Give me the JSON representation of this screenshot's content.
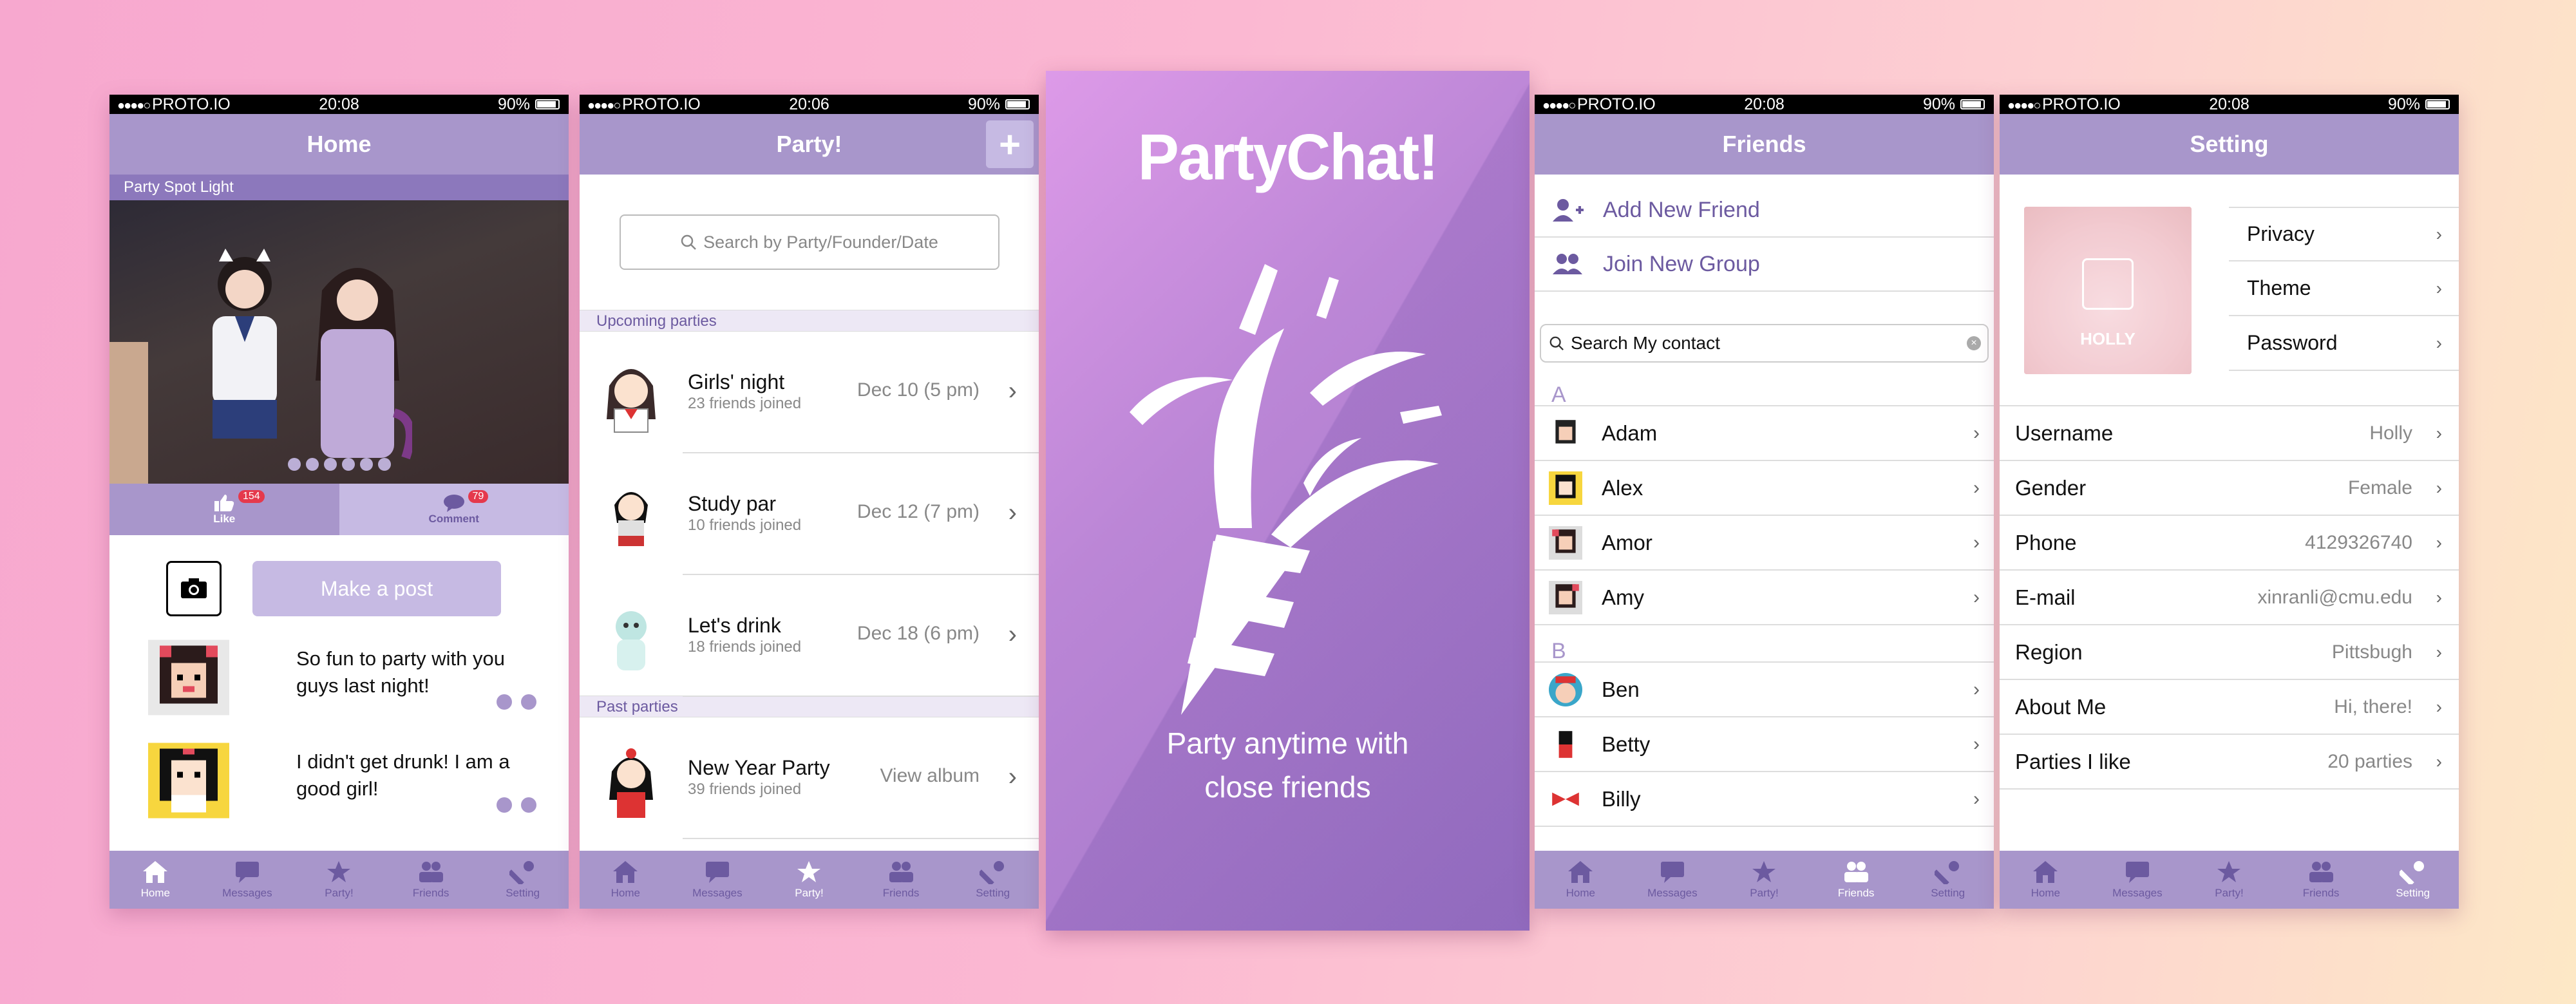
{
  "status": {
    "carrier": "PROTO.IO",
    "battery": "90%",
    "time_home": "20:08",
    "time_party": "20:06",
    "time_friends": "20:08",
    "time_setting": "20:08"
  },
  "tabs": {
    "home": "Home",
    "messages": "Messages",
    "party": "Party!",
    "friends": "Friends",
    "setting": "Setting"
  },
  "home": {
    "title": "Home",
    "spotlight_label": "Party Spot Light",
    "like_label": "Like",
    "like_count": "154",
    "comment_label": "Comment",
    "comment_count": "79",
    "make_post": "Make a post",
    "feed": [
      {
        "text": "So fun to party with you guys last night!"
      },
      {
        "text": "I didn't get drunk! I am a good girl!"
      }
    ]
  },
  "party": {
    "title": "Party!",
    "add_label": "+",
    "search_placeholder": "Search by Party/Founder/Date",
    "upcoming_header": "Upcoming parties",
    "past_header": "Past parties",
    "upcoming": [
      {
        "name": "Girls' night",
        "sub": "23 friends joined",
        "date": "Dec 10 (5 pm)"
      },
      {
        "name": "Study par",
        "sub": "10 friends joined",
        "date": "Dec 12 (7 pm)"
      },
      {
        "name": "Let's drink",
        "sub": "18 friends joined",
        "date": "Dec 18 (6 pm)"
      }
    ],
    "past": [
      {
        "name": "New Year Party",
        "sub": "39 friends joined",
        "date": "View album"
      }
    ]
  },
  "splash": {
    "logo": "PartyChat!",
    "tagline_1": "Party anytime with",
    "tagline_2": "close friends"
  },
  "friends": {
    "title": "Friends",
    "add_friend": "Add New Friend",
    "join_group": "Join New Group",
    "search_value": "Search My contact",
    "sections": [
      {
        "letter": "A",
        "names": [
          "Adam",
          "Alex",
          "Amor",
          "Amy"
        ]
      },
      {
        "letter": "B",
        "names": [
          "Ben",
          "Betty",
          "Billy"
        ]
      }
    ]
  },
  "setting": {
    "title": "Setting",
    "avatar_name": "HOLLY",
    "menu": [
      "Privacy",
      "Theme",
      "Password"
    ],
    "rows": [
      {
        "label": "Username",
        "value": "Holly"
      },
      {
        "label": "Gender",
        "value": "Female"
      },
      {
        "label": "Phone",
        "value": "4129326740"
      },
      {
        "label": "E-mail",
        "value": "xinranli@cmu.edu"
      },
      {
        "label": "Region",
        "value": "Pittsbugh"
      },
      {
        "label": "About Me",
        "value": "Hi, there!"
      },
      {
        "label": "Parties I like",
        "value": "20 parties"
      }
    ]
  },
  "colors": {
    "accent": "#a896cb",
    "accent_dark": "#6c5aa0",
    "badge": "#e5394c"
  }
}
